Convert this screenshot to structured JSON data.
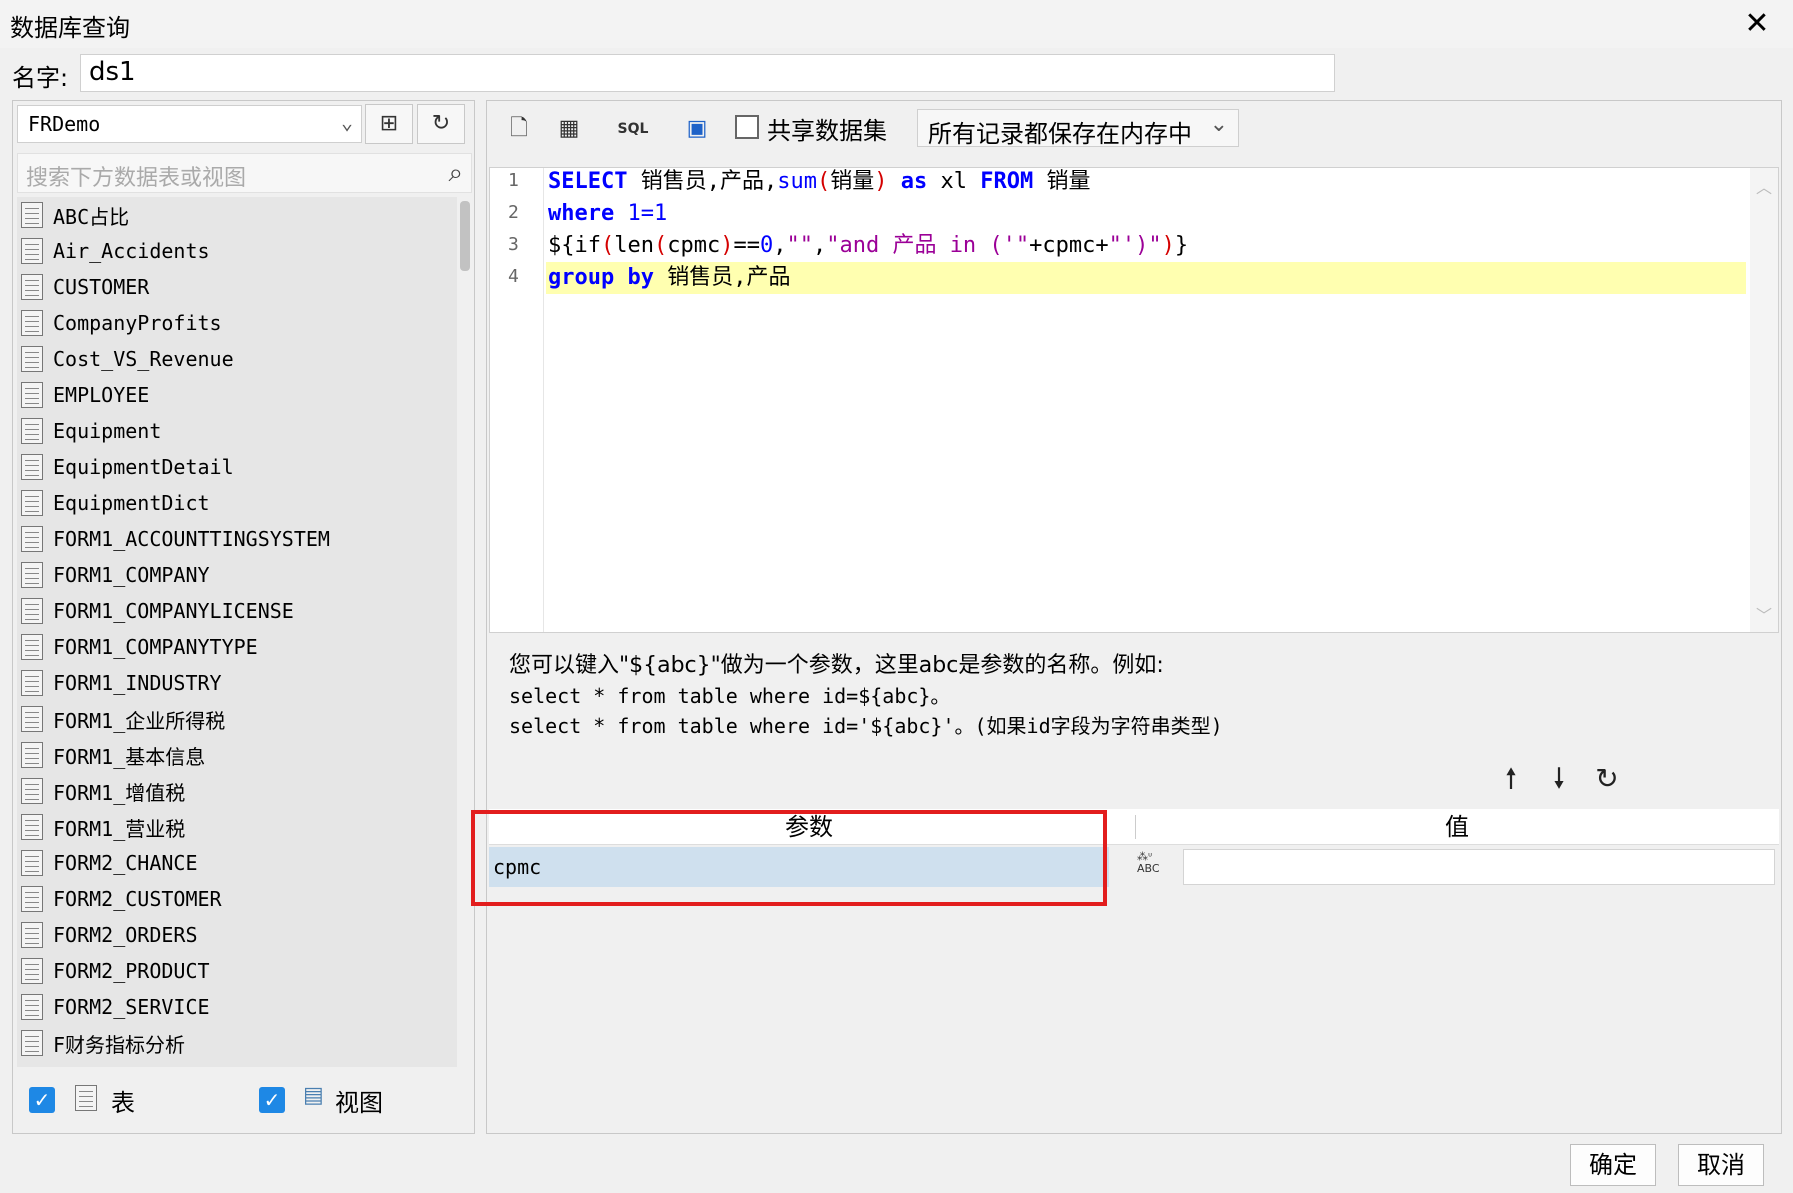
{
  "window": {
    "title": "数据库查询",
    "close_glyph": "✕"
  },
  "name_field": {
    "label": "名字:",
    "value": "ds1"
  },
  "left": {
    "connection": "FRDemo",
    "search_placeholder": "搜索下方数据表或视图",
    "tables": [
      "ABC占比",
      "Air_Accidents",
      "CUSTOMER",
      "CompanyProfits",
      "Cost_VS_Revenue",
      "EMPLOYEE",
      "Equipment",
      "EquipmentDetail",
      "EquipmentDict",
      "FORM1_ACCOUNTTINGSYSTEM",
      "FORM1_COMPANY",
      "FORM1_COMPANYLICENSE",
      "FORM1_COMPANYTYPE",
      "FORM1_INDUSTRY",
      "FORM1_企业所得税",
      "FORM1_基本信息",
      "FORM1_增值税",
      "FORM1_营业税",
      "FORM2_CHANCE",
      "FORM2_CUSTOMER",
      "FORM2_ORDERS",
      "FORM2_PRODUCT",
      "FORM2_SERVICE",
      "F财务指标分析"
    ],
    "filter_table_label": "表",
    "filter_view_label": "视图"
  },
  "toolbar": {
    "share_label": "共享数据集",
    "mode_value": "所有记录都保存在内存中"
  },
  "editor": {
    "line_numbers": [
      "1",
      "2",
      "3",
      "4"
    ]
  },
  "hint": {
    "line1": "您可以键入\"${abc}\"做为一个参数，这里abc是参数的名称。例如:",
    "line2": "select * from table where id=${abc}。",
    "line3": "select * from table where id='${abc}'。(如果id字段为字符串类型)"
  },
  "params": {
    "header_param": "参数",
    "header_value": "值",
    "rows": [
      {
        "name": "cpmc",
        "type_icon": "ABC",
        "value": ""
      }
    ]
  },
  "footer": {
    "ok": "确定",
    "cancel": "取消"
  },
  "colors": {
    "highlight": "#e21d1d",
    "selected_row": "#cfe0ee",
    "current_line": "#ffffb0"
  }
}
